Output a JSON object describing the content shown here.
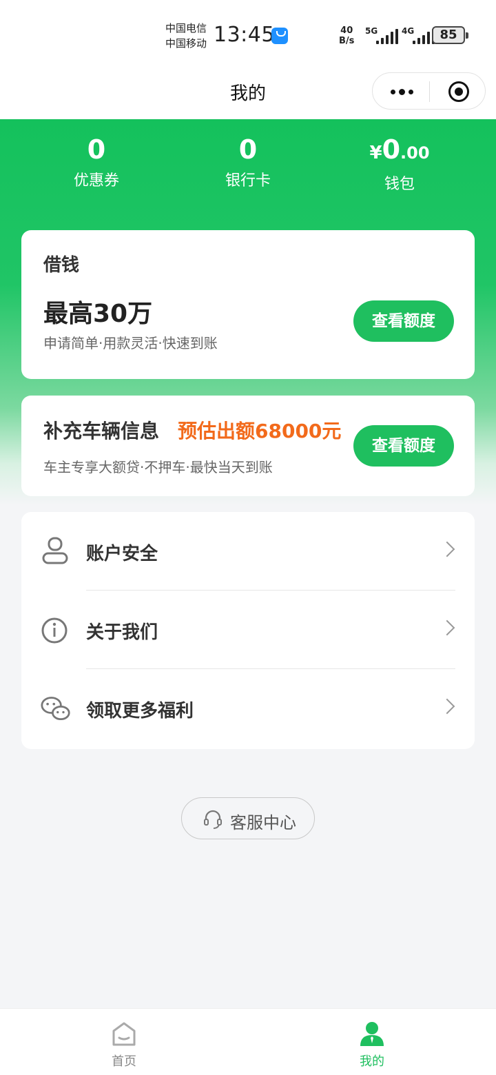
{
  "status_bar": {
    "carrier_1": "中国电信",
    "carrier_2": "中国移动",
    "time": "13:45",
    "net_speed_value": "40",
    "net_speed_unit": "B/s",
    "signal_1_type": "5G",
    "signal_2_type": "4G",
    "battery": "85"
  },
  "title_bar": {
    "title": "我的",
    "more_icon": "more-dots-icon",
    "close_icon": "target-close-icon"
  },
  "stats": [
    {
      "value": "0",
      "label": "优惠券"
    },
    {
      "value": "0",
      "label": "银行卡"
    },
    {
      "currency": "¥",
      "value_int": "0",
      "value_dec": ".00",
      "label": "钱包"
    }
  ],
  "loan_card": {
    "title": "借钱",
    "amount": "最高30万",
    "desc": "申请简单·用款灵活·快速到账",
    "button": "查看额度"
  },
  "car_card": {
    "title": "补充车辆信息",
    "estimate": "预估出额68000元",
    "desc": "车主专享大额贷·不押车·最快当天到账",
    "button": "查看额度"
  },
  "menu": [
    {
      "icon": "user-icon",
      "label": "账户安全"
    },
    {
      "icon": "info-icon",
      "label": "关于我们"
    },
    {
      "icon": "wechat-icon",
      "label": "领取更多福利"
    }
  ],
  "customer_service": {
    "icon": "headset-icon",
    "label": "客服中心"
  },
  "tabs": [
    {
      "icon": "home-icon",
      "label": "首页",
      "active": false
    },
    {
      "icon": "person-icon",
      "label": "我的",
      "active": true
    }
  ],
  "colors": {
    "brand_green": "#1fbf5f",
    "highlight_orange": "#f26a1b",
    "background": "#f4f5f7"
  }
}
